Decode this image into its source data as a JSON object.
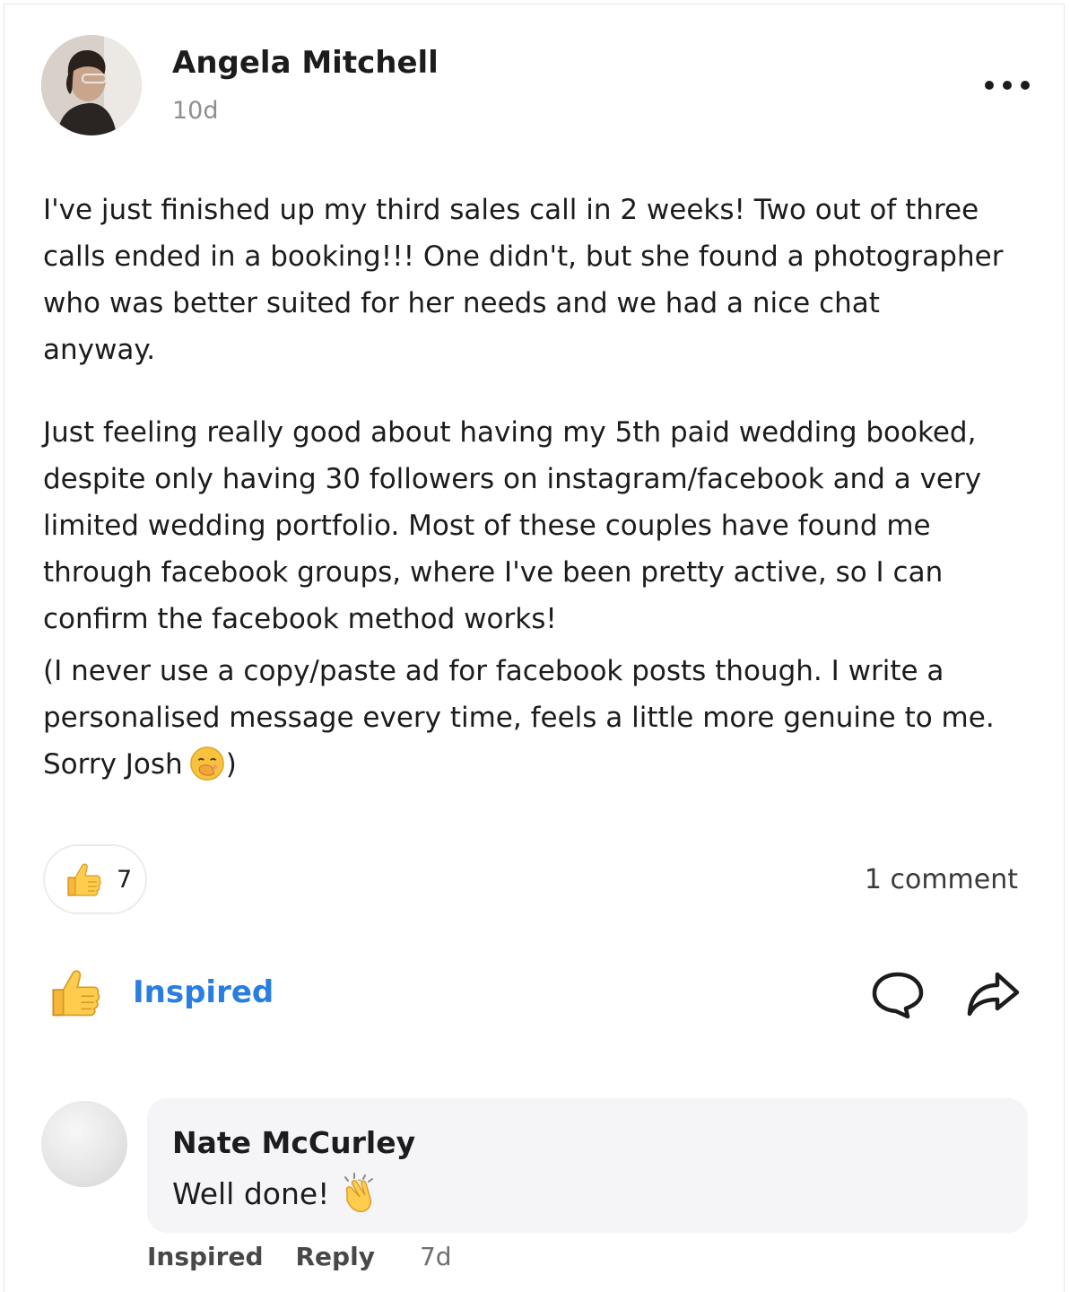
{
  "post": {
    "author": "Angela Mitchell",
    "time": "10d",
    "lines_p1": [
      "I've just finished up my third sales call in 2 weeks! Two out of three",
      "calls ended in a booking!!! One didn't, but she found a photographer",
      "who was better suited for her needs and we had a nice chat",
      "anyway."
    ],
    "lines_p2": [
      "Just feeling really good about having my 5th paid wedding booked,",
      "despite only having 30 followers on instagram/facebook and a very",
      "limited wedding portfolio. Most of these couples have found me",
      "through facebook groups, where I've been pretty active, so I can",
      "confirm the facebook method works!"
    ],
    "lines_p3": [
      "(I never use a copy/paste ad for facebook posts though. I write a",
      "personalised message every time, feels a little more genuine to me.",
      "Sorry Josh",
      ")"
    ]
  },
  "reactions": {
    "count": "7",
    "comment_count": "1 comment"
  },
  "actions": {
    "inspired_label": "Inspired"
  },
  "comment": {
    "author": "Nate McCurley",
    "text": "Well done!",
    "meta": {
      "inspired": "Inspired",
      "reply": "Reply",
      "time": "7d"
    }
  },
  "icons": {
    "more": "more-horizontal-icon",
    "thumbs_up": "thumbs-up-emoji-icon",
    "comment": "comment-bubble-icon",
    "share": "share-arrow-icon",
    "face": "face-with-hand-over-mouth-emoji-icon",
    "clap": "clapping-hands-emoji-icon"
  },
  "colors": {
    "accent_blue": "#2a7de1",
    "text_primary": "#1c1c1e",
    "text_secondary": "#8e8e93",
    "bubble_bg": "#f5f5f7"
  }
}
